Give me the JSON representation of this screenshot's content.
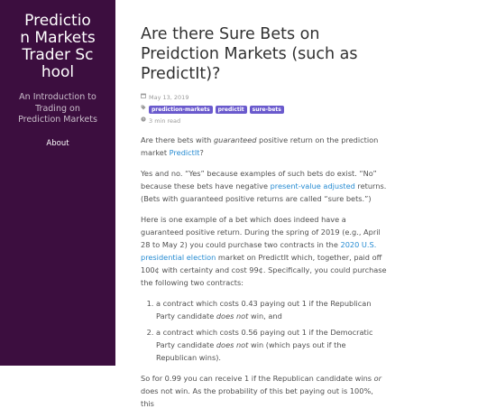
{
  "sidebar": {
    "site_title": "Prediction Markets Trader School",
    "tagline": "An Introduction to Trading on Prediction Markets",
    "nav_about": "About",
    "bg_color": "#3c0e3f"
  },
  "post": {
    "title": "Are there Sure Bets on Preidction Markets (such as PredictIt)?",
    "date": "May 13, 2019",
    "tags": [
      "prediction-markets",
      "predictit",
      "sure-bets"
    ],
    "read_time": "3 min read",
    "icons": {
      "date": "calendar-icon",
      "tags": "tag-icon",
      "read_time": "clock-icon"
    },
    "p1": {
      "pre": "Are there bets with ",
      "em": "guaranteed",
      "mid": " positive return on the prediction market ",
      "link": "PredictIt",
      "post": "?"
    },
    "p2": {
      "pre": "Yes and no. “Yes” because examples of such bets do exist. “No” because these bets have negative ",
      "link": "present-value adjusted",
      "post": " returns. (Bets with guaranteed positive returns are called “sure bets.”)"
    },
    "p3": {
      "pre": "Here is one example of a bet which does indeed have a guaranteed positive return. During the spring of 2019 (e.g., April 28 to May 2) you could purchase two contracts in the ",
      "link": "2020 U.S. presidential election",
      "post": " market on PredictIt which, together, paid off 100¢ with certainty and cost 99¢. Specifically, you could purchase the following two contracts:"
    },
    "list": [
      {
        "pre": "a contract which costs 0.43 paying out 1 if the Republican Party candidate ",
        "em": "does not",
        "post": " win, and"
      },
      {
        "pre": "a contract which costs 0.56 paying out 1 if the Democratic Party candidate ",
        "em": "does not",
        "post": " win (which pays out if the Republican wins)."
      }
    ],
    "p4": {
      "pre": "So for 0.99 you can receive 1 if the Republican candidate wins ",
      "em": "or",
      "post": " does not win. As the probability of this bet paying out is 100%, this"
    },
    "link_color": "#268bd2",
    "tag_color": "#6a5acd"
  }
}
